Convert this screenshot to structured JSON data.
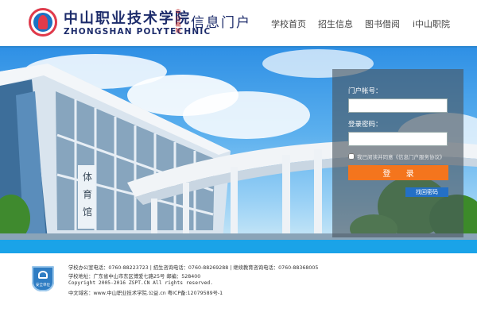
{
  "header": {
    "logo_cn": "中山职业技术学院",
    "logo_en": "ZHONGSHAN POLYTECHNIC",
    "seal_text": "中山職院",
    "portal_title": "信息门户",
    "nav": [
      "学校首页",
      "招生信息",
      "图书借阅",
      "i中山职院"
    ]
  },
  "banner": {
    "building_sign": "体育馆"
  },
  "login": {
    "account_label": "门户帐号：",
    "account_value": "",
    "password_label": "登录密码：",
    "password_value": "",
    "agree_text": "我已阅读并同意《信息门户服务协议》",
    "agree_checked": false,
    "login_button": "登 录",
    "recover_button": "找回密码"
  },
  "footer": {
    "badge_text": "安全单位",
    "line1": "学校办公室电话：0760-88223723 | 招生咨询电话：0760-88269288 | 继续教育咨询电话：0760-88368005",
    "line2": "学校地址：广东省中山市东区博爱七路25号 邮编：528400",
    "line3": "Copyright 2005-2016 ZSPT.CN All rights reserved.",
    "line4": "中文域名：www.中山职业技术学院.公益.cn 粤ICP备:12079589号-1"
  },
  "colors": {
    "navy": "#1d2c6b",
    "login_orange": "#f4751d",
    "recover_blue": "#2470c6",
    "footer_bar": "#1aa3e8"
  }
}
